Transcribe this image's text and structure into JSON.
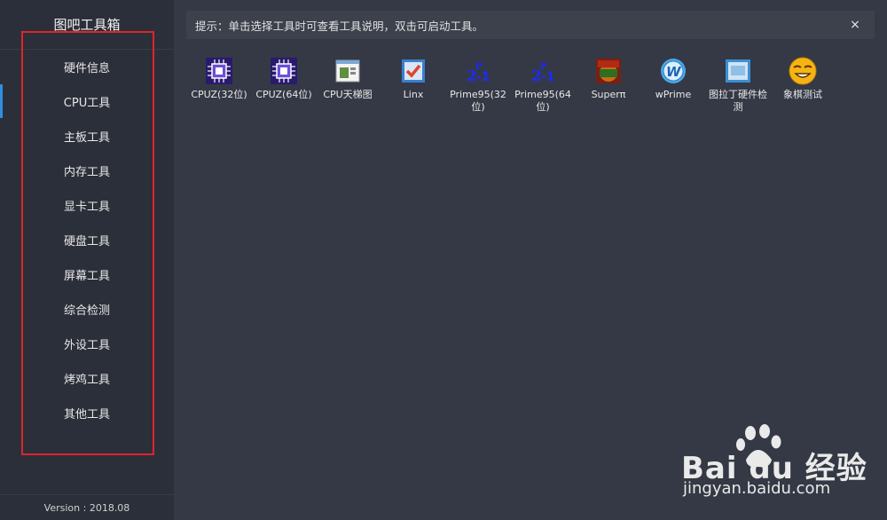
{
  "app": {
    "title": "图吧工具箱",
    "version": "Version : 2018.08"
  },
  "sidebar": {
    "items": [
      {
        "label": "硬件信息"
      },
      {
        "label": "CPU工具"
      },
      {
        "label": "主板工具"
      },
      {
        "label": "内存工具"
      },
      {
        "label": "显卡工具"
      },
      {
        "label": "硬盘工具"
      },
      {
        "label": "屏幕工具"
      },
      {
        "label": "综合检测"
      },
      {
        "label": "外设工具"
      },
      {
        "label": "烤鸡工具"
      },
      {
        "label": "其他工具"
      }
    ],
    "active_index": 1
  },
  "hint": {
    "text": "提示：单击选择工具时可查看工具说明，双击可启动工具。",
    "close_icon": "×"
  },
  "tools": [
    {
      "label": "CPUZ(32位)",
      "icon": "cpuz-icon"
    },
    {
      "label": "CPUZ(64位)",
      "icon": "cpuz-icon"
    },
    {
      "label": "CPU天梯图",
      "icon": "chart-window-icon"
    },
    {
      "label": "Linx",
      "icon": "checkbox-icon"
    },
    {
      "label": "Prime95(32位)",
      "icon": "prime95-icon"
    },
    {
      "label": "Prime95(64位)",
      "icon": "prime95-icon"
    },
    {
      "label": "Superπ",
      "icon": "superpi-icon"
    },
    {
      "label": "wPrime",
      "icon": "wprime-icon"
    },
    {
      "label": "图拉丁硬件检测",
      "icon": "pss-icon"
    },
    {
      "label": "象棋测试",
      "icon": "smiley-icon"
    }
  ],
  "watermark": {
    "brand": "Bai du 经验",
    "url": "jingyan.baidu.com"
  },
  "colors": {
    "accent": "#2f8ee0",
    "highlight_box": "#e0242b"
  }
}
